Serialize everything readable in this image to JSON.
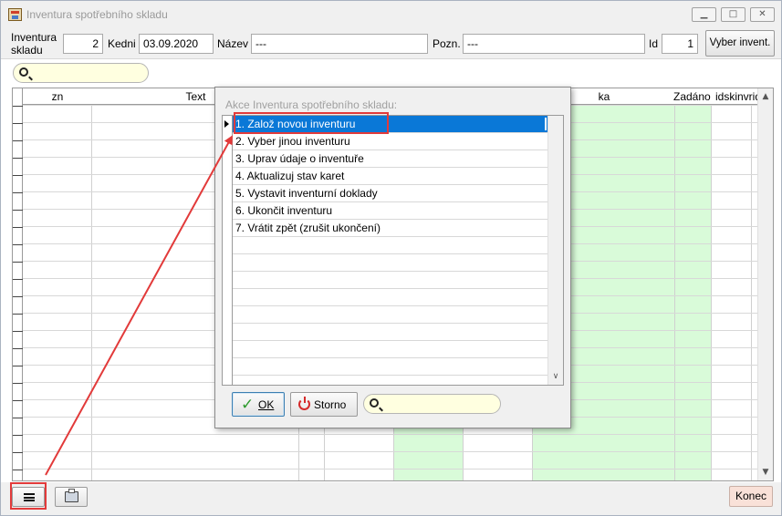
{
  "window": {
    "title": "Inventura spotřebního skladu"
  },
  "toolbar": {
    "inventura_label": "Inventura skladu",
    "inventura_value": "2",
    "kedni_label": "Kedni",
    "kedni_value": "03.09.2020",
    "nazev_label": "Název",
    "nazev_value": "---",
    "pozn_label": "Pozn.",
    "pozn_value": "---",
    "id_label": "Id",
    "id_value": "1",
    "vyber_button": "Vyber invent."
  },
  "search": {
    "value": ""
  },
  "grid": {
    "columns": [
      "zn",
      "Text",
      "",
      "",
      "",
      "",
      "ka",
      "Zadáno",
      "idskinvrid"
    ]
  },
  "dialog": {
    "title": "Akce Inventura spotřebního skladu:",
    "items": [
      "1. Založ novou inventuru",
      "2. Vyber jinou inventuru",
      "3. Uprav údaje o inventuře",
      "4. Aktualizuj stav karet",
      "5. Vystavit inventurní doklady",
      "6. Ukončit inventuru",
      "7. Vrátit zpět (zrušit ukončení)"
    ],
    "selected_index": 0,
    "ok_label": "OK",
    "cancel_label": "Storno",
    "search_value": ""
  },
  "bottom": {
    "close_label": "Konec"
  },
  "colors": {
    "selection": "#0a78d7",
    "highlight_column": "#d9fbd9",
    "annotation": "#e23a3a",
    "search_background": "#ffffe0"
  }
}
